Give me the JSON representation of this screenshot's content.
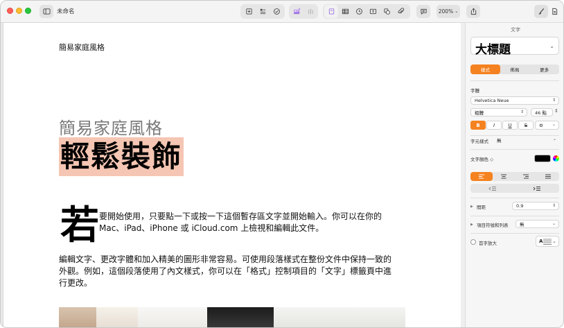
{
  "window": {
    "doc_title": "未命名",
    "zoom": "200%"
  },
  "document": {
    "header": "簡易家庭風格",
    "subtitle": "簡易家庭風格",
    "title": "輕鬆裝飾",
    "dropcap": "若",
    "paragraph1": "要開始使用，只要點一下或按一下這個暫存區文字並開始輸入。你可以在你的 Mac、iPad、iPhone 或 iCloud.com 上檢視和編輯此文件。",
    "paragraph2": "編輯文字、更改字體和加入精美的圖形非常容易。可使用段落樣式在整份文件中保持一致的外觀。例如，這個段落使用了內文樣式，你可以在「格式」控制項目的「文字」標籤頁中進行更改。"
  },
  "inspector": {
    "header": "文字",
    "paragraph_style": "大標題",
    "tabs": [
      "樣式",
      "佈局",
      "更多"
    ],
    "font_label": "字體",
    "font_family": "Helvetica Neue",
    "font_weight": "粗體",
    "font_size": "46 點",
    "bold": "B",
    "italic": "I",
    "underline": "U",
    "strike": "S",
    "char_style_label": "字元樣式",
    "char_style_value": "無",
    "text_color_label": "文字顏色 ◇",
    "spacing_label": "間距",
    "spacing_value": "0.9",
    "bullets_label": "項目符號和列表",
    "bullets_value": "無",
    "dropcap_label": "首字放大",
    "dropcap_preview": "A"
  },
  "colors": {
    "accent": "#f58220",
    "title_highlight": "#f5c6b3"
  }
}
